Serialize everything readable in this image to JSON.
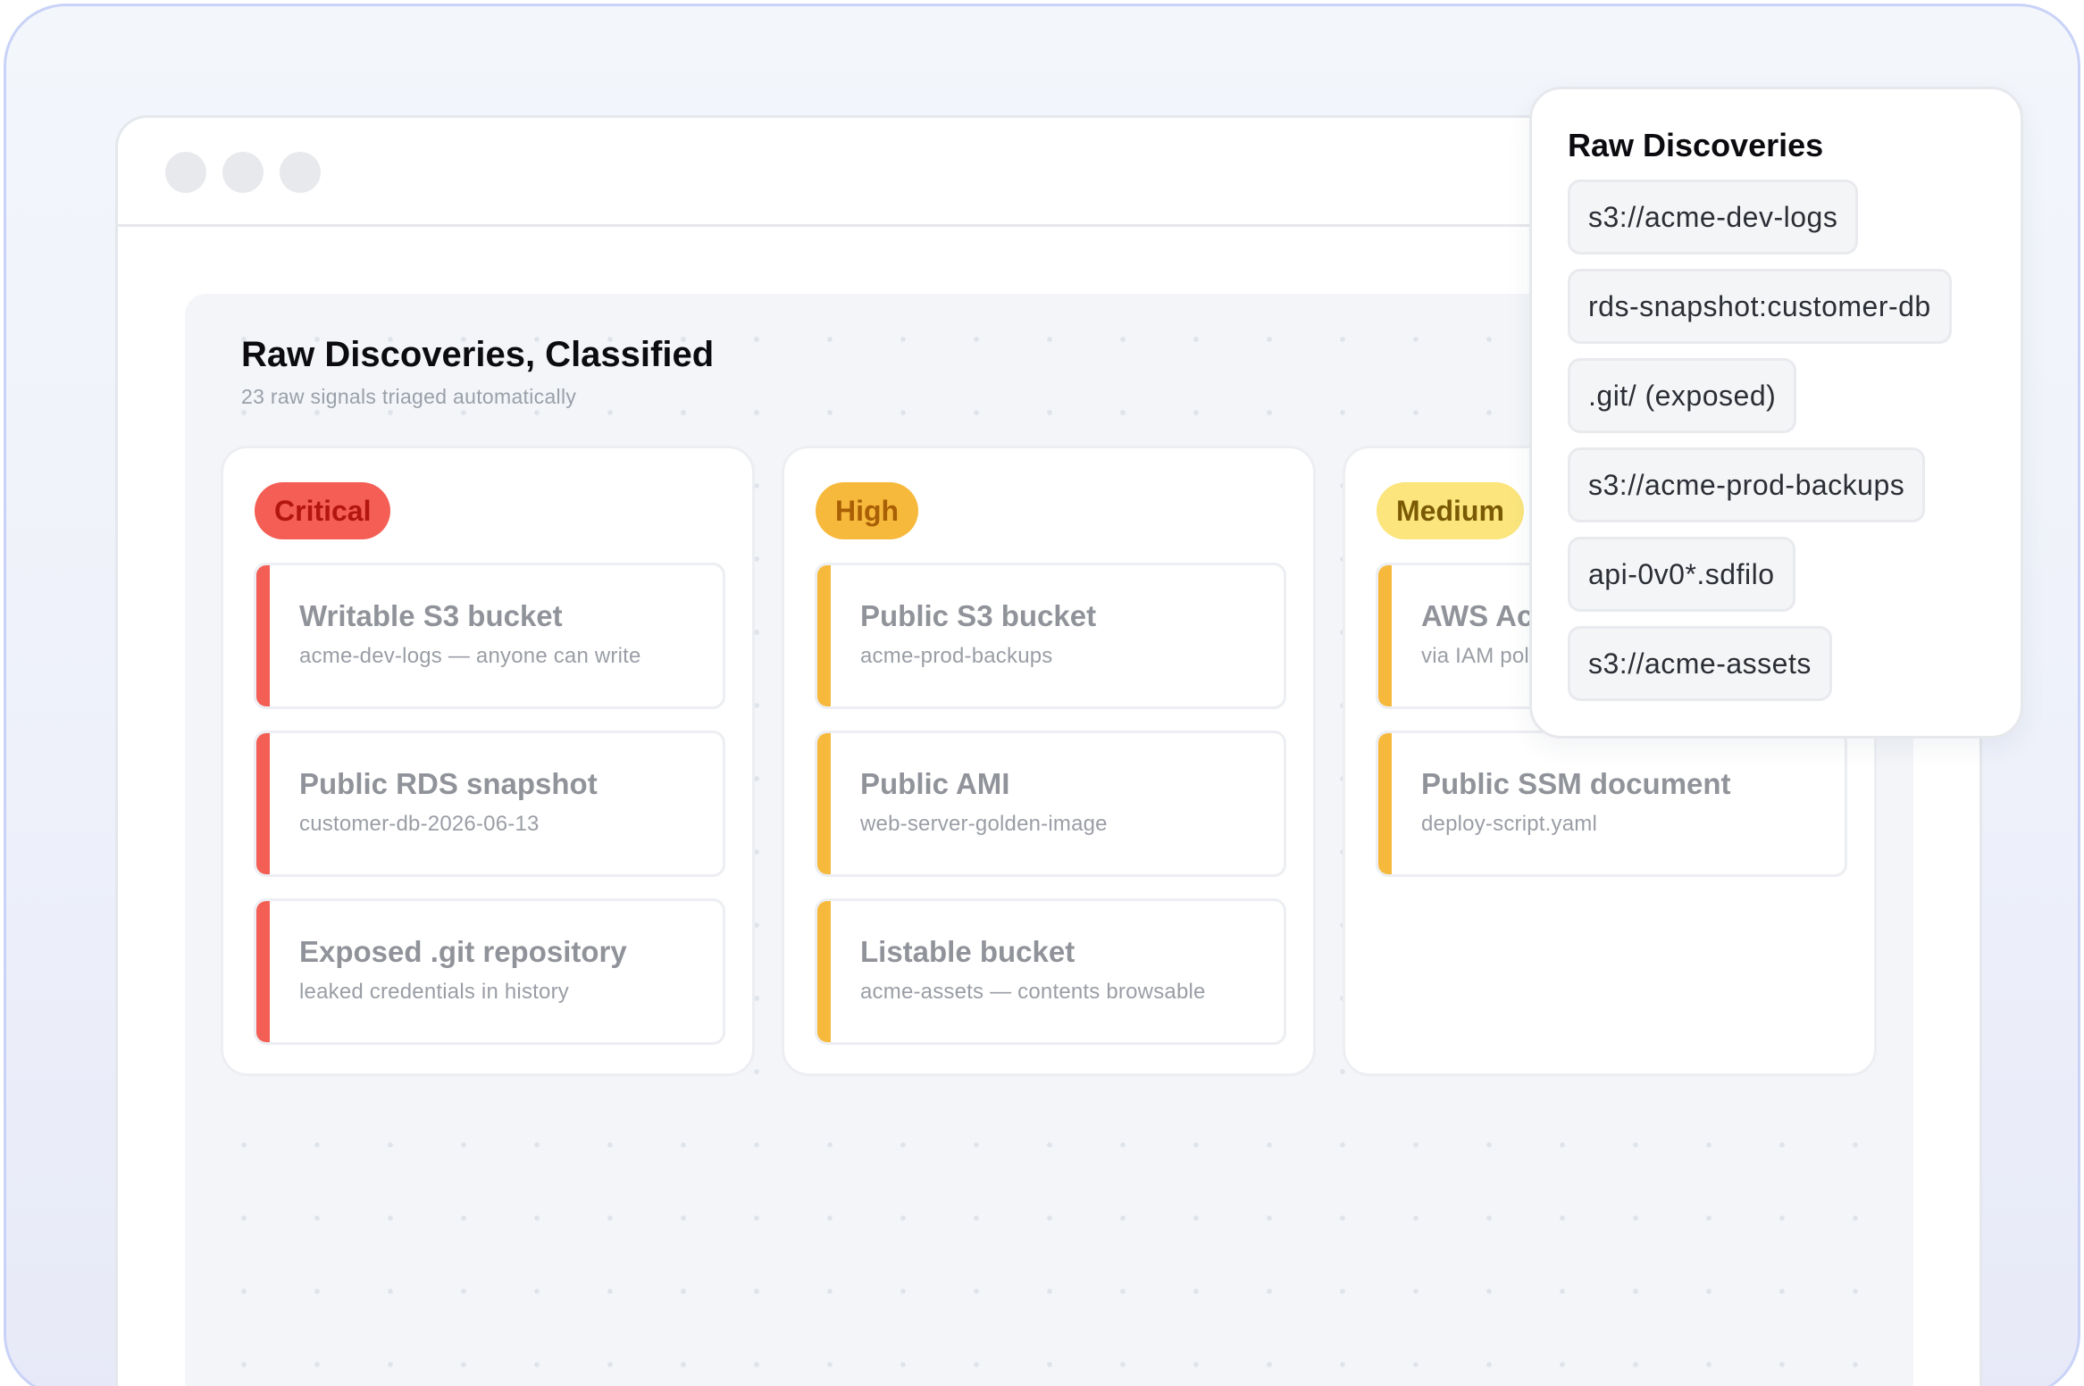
{
  "popup": {
    "title": "Raw Discoveries",
    "items": [
      "s3://acme-dev-logs",
      "rds-snapshot:customer-db",
      ".git/ (exposed)",
      "s3://acme-prod-backups",
      "api-0v0*.sdfilo",
      "s3://acme-assets"
    ]
  },
  "board": {
    "title": "Raw Discoveries, Classified",
    "subtitle": "23 raw signals triaged automatically",
    "columns": [
      {
        "label": "Critical",
        "color": "#f45e55",
        "cards": [
          {
            "title": "Writable S3 bucket",
            "detail": "acme-dev-logs — anyone can write"
          },
          {
            "title": "Public RDS snapshot",
            "detail": "customer-db-2026-06-13"
          },
          {
            "title": "Exposed .git repository",
            "detail": "leaked credentials in history"
          }
        ]
      },
      {
        "label": "High",
        "color": "#f7b93b",
        "cards": [
          {
            "title": "Public S3 bucket",
            "detail": "acme-prod-backups"
          },
          {
            "title": "Public AMI",
            "detail": "web-server-golden-image"
          },
          {
            "title": "Listable bucket",
            "detail": "acme-assets — contents browsable"
          }
        ]
      },
      {
        "label": "Medium",
        "color": "#fbe57c",
        "cards": [
          {
            "title": "AWS Ac",
            "detail": "via IAM pol"
          },
          {
            "title": "Public SSM document",
            "detail": "deploy-script.yaml"
          }
        ]
      }
    ]
  }
}
